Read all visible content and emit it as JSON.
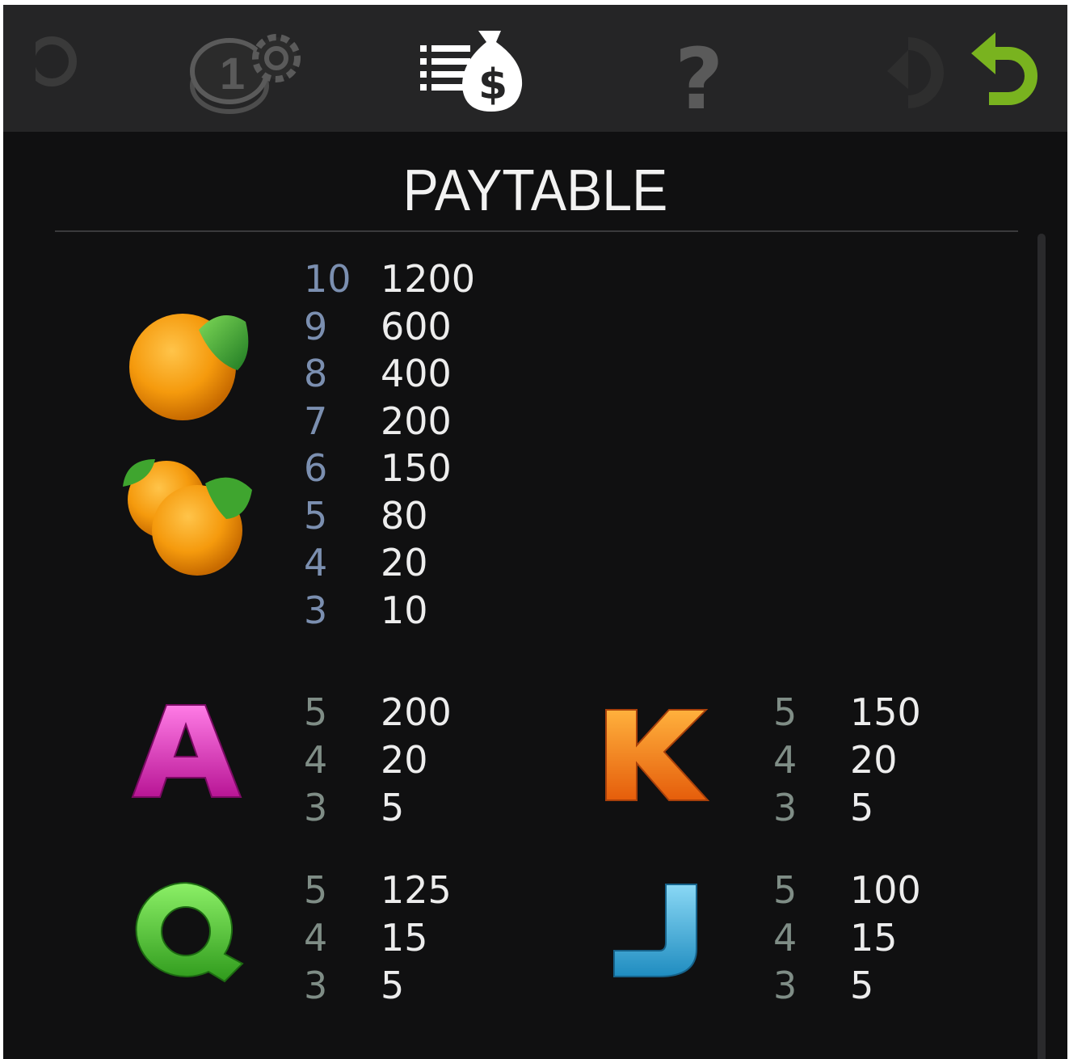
{
  "toolbar": {
    "icons": [
      "settings-icon",
      "bet-settings-icon",
      "paytable-icon",
      "help-icon",
      "undo-icon",
      "back-icon"
    ],
    "colors": {
      "active": "#ffffff",
      "inactive": "#5a5a5a",
      "back": "#79b31f"
    }
  },
  "title": "PAYTABLE",
  "groups": [
    {
      "symbol": "oranges",
      "rows": [
        {
          "count": "10",
          "value": "1200"
        },
        {
          "count": "9",
          "value": "600"
        },
        {
          "count": "8",
          "value": "400"
        },
        {
          "count": "7",
          "value": "200"
        },
        {
          "count": "6",
          "value": "150"
        },
        {
          "count": "5",
          "value": "80"
        },
        {
          "count": "4",
          "value": "20"
        },
        {
          "count": "3",
          "value": "10"
        }
      ]
    },
    {
      "symbol": "A",
      "rows": [
        {
          "count": "5",
          "value": "200"
        },
        {
          "count": "4",
          "value": "20"
        },
        {
          "count": "3",
          "value": "5"
        }
      ]
    },
    {
      "symbol": "K",
      "rows": [
        {
          "count": "5",
          "value": "150"
        },
        {
          "count": "4",
          "value": "20"
        },
        {
          "count": "3",
          "value": "5"
        }
      ]
    },
    {
      "symbol": "Q",
      "rows": [
        {
          "count": "5",
          "value": "125"
        },
        {
          "count": "4",
          "value": "15"
        },
        {
          "count": "3",
          "value": "5"
        }
      ]
    },
    {
      "symbol": "J",
      "rows": [
        {
          "count": "5",
          "value": "100"
        },
        {
          "count": "4",
          "value": "15"
        },
        {
          "count": "3",
          "value": "5"
        }
      ]
    }
  ],
  "colors": {
    "background": "#101011",
    "toolbar": "#252526",
    "count_blue": "#7b8fb0",
    "count_gray": "#7f8d86",
    "value": "#ededed",
    "A": "#e33bc4",
    "K": "#f28a1a",
    "Q": "#5ccf3b",
    "J": "#48b4df"
  }
}
